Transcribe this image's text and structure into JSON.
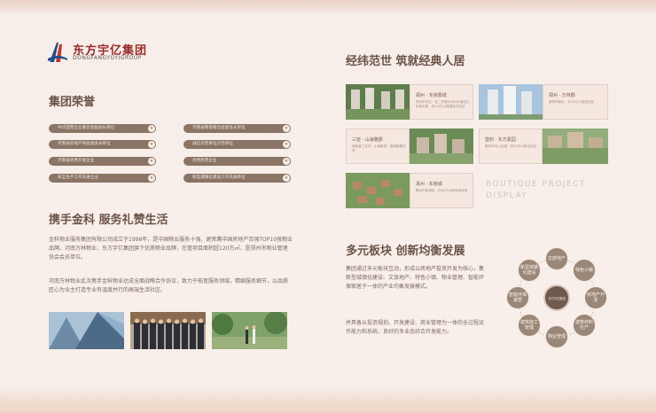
{
  "logo": {
    "cn": "东方宇亿集团",
    "en": "DONGFANGYUYIGROUP"
  },
  "left": {
    "honors_title": "集团荣誉",
    "honors": [
      "中华国营企业联合会副会长单位",
      "河南省房地产商会副会长单位",
      "河南省优秀开发企业",
      "安全生产工作先进企业",
      "河南省慈善联合会副会长单位",
      "诚信示范单位示范单位",
      "优秀民营企业",
      "新型城镇化建设工作先进单位"
    ],
    "service_title": "携手金科  服务礼赞生活",
    "para1": "金科物业服务集团有限公司成立于1998年，是中国物业服务十强，更荣膺中国房地产百强TOP10强物业品牌。河南万林物业、东方宇亿集团旗下优质物业品牌，在管项目面积超120万㎡，是郑州市物业管理协会会员单位。",
    "para2": "河南万林物业此次携手金科物业达成全面战略合作协议，致力于拓宽服务领域，精细服务细节，以品质匠心为业主打造专业有温度并行的高端生活社区。"
  },
  "right": {
    "projects_title": "经纬范世  筑就经典人居",
    "projects": [
      {
        "name": "郑州 · 东房郡城",
        "desc": "郑州市东区 · 北二环路与中州大道交汇处西北角 · 约4.8万㎡高端住宅社区"
      },
      {
        "name": "郑州 · 万林郡",
        "desc": "新郑市新区 · 约12万㎡宜居社区"
      },
      {
        "name": "三亚 · 山海雅郡",
        "desc": "海南省三亚市 · 山海景观 · 高端度假住宅"
      },
      {
        "name": "登封 · 东方嘉园",
        "desc": "登封市中心区域 · 约20万㎡综合社区"
      },
      {
        "name": "禹州 · 东裕城",
        "desc": "禹州市新城区 · 约40万㎡城市综合体"
      }
    ],
    "boutique": [
      "BOUTIQUE PROJECT",
      "DISPLAY"
    ],
    "multi_title": "多元板块  创新均衡发展",
    "para1": "集团通过多元板块互动，形成以房地产投资开发为核心，集新型城镇化建设、文旅地产、特色小镇、物业管理、智能环保家居于一体的产业均衡发展模式。",
    "para2": "并具备从投资规划、开发建设、商业管理为一体的全过程运作能力和系统，良好的多业态综合开发能力。",
    "hub": "东方宇亿集团",
    "nodes": [
      "文旅地产",
      "特色小镇",
      "房地产开发",
      "建筑材料生产",
      "物业管理",
      "建筑施工管理",
      "智能环保家居",
      "新型城镇化建设"
    ]
  },
  "colors": {
    "brand_red": "#9a2a2a",
    "brand_blue": "#1f4e8c",
    "pill": "#8a7466",
    "node": "#9a8778"
  }
}
